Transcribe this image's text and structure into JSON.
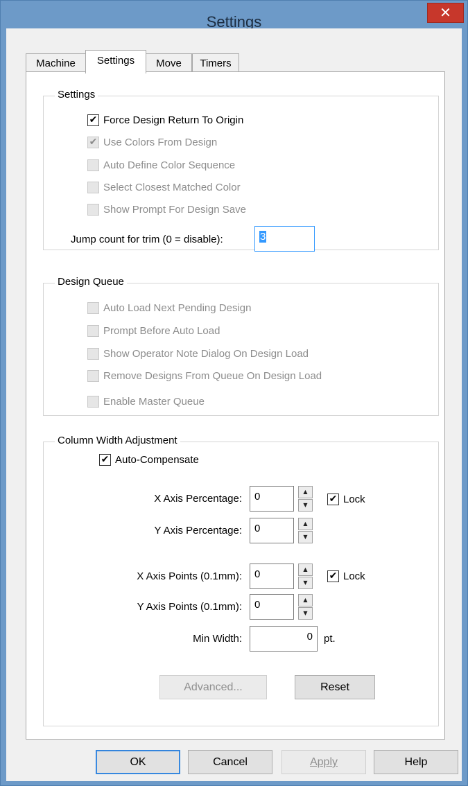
{
  "window": {
    "title": "Settings",
    "close_glyph": "✕"
  },
  "tabs": [
    {
      "label": "Machine",
      "active": false
    },
    {
      "label": "Settings",
      "active": true
    },
    {
      "label": "Move",
      "active": false
    },
    {
      "label": "Timers",
      "active": false
    }
  ],
  "settings_group": {
    "title": "Settings",
    "options": [
      {
        "label": "Force Design Return To Origin",
        "checked": true,
        "enabled": true
      },
      {
        "label": "Use Colors From Design",
        "checked": true,
        "enabled": false
      },
      {
        "label": "Auto Define Color Sequence",
        "checked": false,
        "enabled": false
      },
      {
        "label": "Select Closest Matched Color",
        "checked": false,
        "enabled": false
      },
      {
        "label": "Show Prompt For Design Save",
        "checked": false,
        "enabled": false
      }
    ],
    "jump_label": "Jump count for trim (0 = disable):",
    "jump_value": "3"
  },
  "queue_group": {
    "title": "Design Queue",
    "options": [
      {
        "label": "Auto Load Next Pending Design",
        "checked": false,
        "enabled": false
      },
      {
        "label": "Prompt Before Auto Load",
        "checked": false,
        "enabled": false
      },
      {
        "label": "Show Operator Note Dialog On Design Load",
        "checked": false,
        "enabled": false
      },
      {
        "label": "Remove Designs From Queue On Design Load",
        "checked": false,
        "enabled": false
      },
      {
        "label": "Enable Master Queue",
        "checked": false,
        "enabled": false
      }
    ]
  },
  "column_group": {
    "title": "Column Width Adjustment",
    "auto_compensate": {
      "label": "Auto-Compensate",
      "checked": true
    },
    "x_pct": {
      "label": "X Axis Percentage:",
      "value": "0"
    },
    "y_pct": {
      "label": "Y Axis Percentage:",
      "value": "0"
    },
    "x_pts": {
      "label": "X Axis Points (0.1mm):",
      "value": "0"
    },
    "y_pts": {
      "label": "Y Axis Points (0.1mm):",
      "value": "0"
    },
    "lock_pct": {
      "label": "Lock",
      "checked": true
    },
    "lock_pts": {
      "label": "Lock",
      "checked": true
    },
    "min_width": {
      "label": "Min Width:",
      "value": "0",
      "unit": "pt."
    },
    "advanced_label": "Advanced...",
    "reset_label": "Reset"
  },
  "footer": {
    "ok_label": "OK",
    "cancel_label": "Cancel",
    "apply_label": "Apply",
    "help_label": "Help"
  },
  "icons": {
    "check": "check-mark",
    "spin_up": "arrow-up",
    "spin_down": "arrow-down"
  },
  "colors": {
    "titlebar": "#6d9ac8",
    "close": "#c7372b",
    "focus": "#3399ff"
  }
}
